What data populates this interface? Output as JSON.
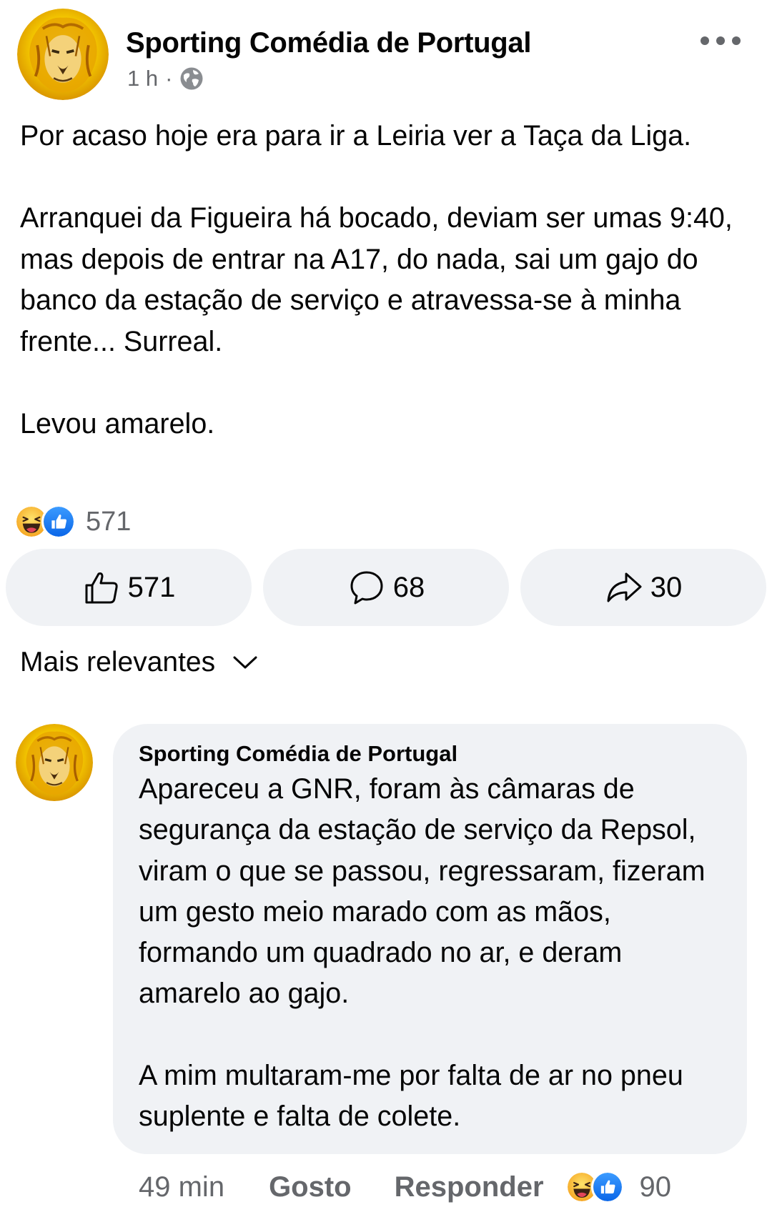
{
  "post": {
    "author": "Sporting Comédia de Portugal",
    "time": "1 h",
    "separator": "·",
    "audience_icon": "globe-icon",
    "text": "Por acaso hoje era para ir a Leiria ver a Taça da Liga.\n\nArranquei da Figueira há bocado, deviam ser umas 9:40, mas depois de entrar na A17, do nada, sai um gajo do banco da estação de serviço e atravessa-se à minha frente... Surreal.\n\nLevou amarelo.",
    "reactions_total": "571",
    "reaction_icons": [
      "haha-icon",
      "like-icon"
    ]
  },
  "actions": {
    "like_count": "571",
    "comment_count": "68",
    "share_count": "30"
  },
  "sort": {
    "label": "Mais relevantes"
  },
  "comment": {
    "author": "Sporting Comédia de Portugal",
    "text": "Apareceu a GNR, foram às câmaras de segurança da estação de serviço da Repsol, viram o que se passou, regressaram, fizeram um gesto meio marado com as mãos, formando um quadrado no ar, e deram amarelo ao gajo.\n\nA mim multaram-me por falta de ar no pneu suplente e falta de colete.",
    "time": "49 min",
    "like_label": "Gosto",
    "reply_label": "Responder",
    "reactions_total": "90"
  },
  "colors": {
    "secondary_text": "#65676b",
    "button_bg": "#f0f2f5",
    "like_blue": "#1877f2",
    "haha_yellow": "#fcc433"
  }
}
